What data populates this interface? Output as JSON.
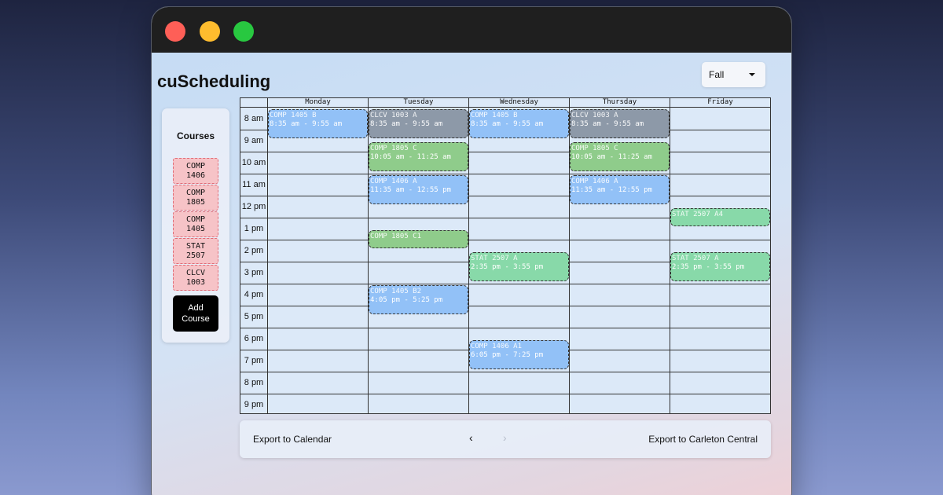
{
  "window": {
    "controls": [
      "close",
      "minimize",
      "zoom"
    ]
  },
  "app": {
    "title": "cuScheduling"
  },
  "term_select": {
    "value": "Fall",
    "icon": "chevron-down-icon"
  },
  "sidebar": {
    "title": "Courses",
    "courses": [
      "COMP\n1406",
      "COMP\n1805",
      "COMP\n1405",
      "STAT\n2507",
      "CLCV\n1003"
    ],
    "add_label": "Add\nCourse"
  },
  "calendar": {
    "days": [
      "Monday",
      "Tuesday",
      "Wednesday",
      "Thursday",
      "Friday"
    ],
    "times": [
      "8 am",
      "9 am",
      "10 am",
      "11 am",
      "12 pm",
      "1 pm",
      "2 pm",
      "3 pm",
      "4 pm",
      "5 pm",
      "6 pm",
      "7 pm",
      "8 pm",
      "9 pm"
    ],
    "events": [
      {
        "day": 0,
        "start": 8.583,
        "end": 9.917,
        "name": "COMP 1405 B",
        "time": "8:35 am - 9:55 am",
        "color": "blue"
      },
      {
        "day": 1,
        "start": 8.583,
        "end": 9.917,
        "name": "CLCV 1003 A",
        "time": "8:35 am - 9:55 am",
        "color": "gray"
      },
      {
        "day": 2,
        "start": 8.583,
        "end": 9.917,
        "name": "COMP 1405 B",
        "time": "8:35 am - 9:55 am",
        "color": "blue"
      },
      {
        "day": 3,
        "start": 8.583,
        "end": 9.917,
        "name": "CLCV 1003 A",
        "time": "8:35 am - 9:55 am",
        "color": "gray"
      },
      {
        "day": 1,
        "start": 10.083,
        "end": 11.417,
        "name": "COMP 1805 C",
        "time": "10:05 am - 11:25 am",
        "color": "green"
      },
      {
        "day": 3,
        "start": 10.083,
        "end": 11.417,
        "name": "COMP 1805 C",
        "time": "10:05 am - 11:25 am",
        "color": "green"
      },
      {
        "day": 1,
        "start": 11.583,
        "end": 12.917,
        "name": "COMP 1406 A",
        "time": "11:35 am - 12:55 pm",
        "color": "blue"
      },
      {
        "day": 3,
        "start": 11.583,
        "end": 12.917,
        "name": "COMP 1406 A",
        "time": "11:35 am - 12:55 pm",
        "color": "blue"
      },
      {
        "day": 4,
        "start": 13.083,
        "end": 13.917,
        "name": "STAT 2507 A4",
        "time": "",
        "color": "mint"
      },
      {
        "day": 1,
        "start": 14.083,
        "end": 14.917,
        "name": "COMP 1805 C1",
        "time": "",
        "color": "green"
      },
      {
        "day": 2,
        "start": 15.083,
        "end": 16.417,
        "name": "STAT 2507 A",
        "time": "2:35 pm - 3:55 pm",
        "color": "mint"
      },
      {
        "day": 4,
        "start": 15.083,
        "end": 16.417,
        "name": "STAT 2507 A",
        "time": "2:35 pm - 3:55 pm",
        "color": "mint"
      },
      {
        "day": 1,
        "start": 16.583,
        "end": 17.917,
        "name": "COMP 1405 B2",
        "time": "4:05 pm - 5:25 pm",
        "color": "blue"
      },
      {
        "day": 2,
        "start": 19.083,
        "end": 20.417,
        "name": "COMP 1406 A1",
        "time": "6:05 pm - 7:25 pm",
        "color": "blue"
      }
    ]
  },
  "footer": {
    "export_calendar": "Export to Calendar",
    "export_carleton": "Export to Carleton Central",
    "prev_icon": "chevron-left-icon",
    "next_icon": "chevron-right-icon",
    "prev_glyph": "‹",
    "next_glyph": "›"
  }
}
